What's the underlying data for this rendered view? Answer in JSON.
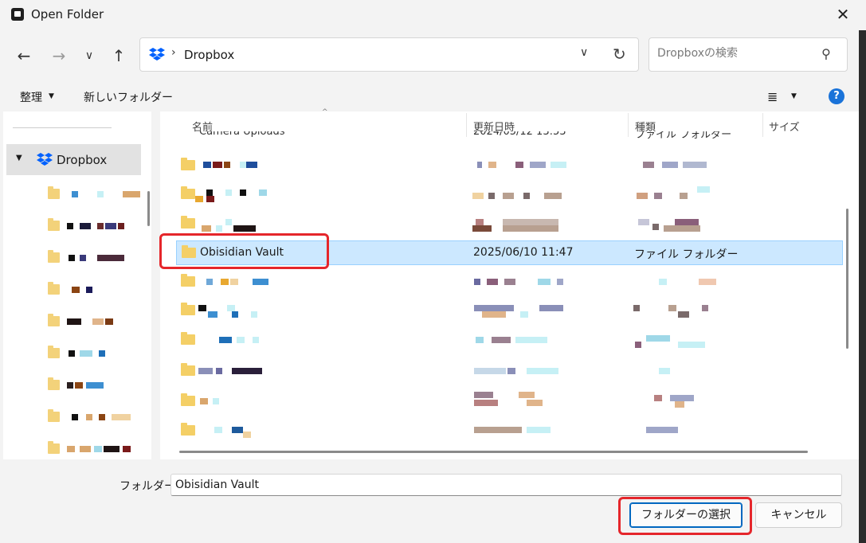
{
  "window": {
    "title": "Open Folder",
    "close_glyph": "✕"
  },
  "navigation": {
    "back_glyph": "←",
    "forward_glyph": "→",
    "recent_glyph": "∨",
    "up_glyph": "↑"
  },
  "address_bar": {
    "separator": "›",
    "path": "Dropbox",
    "chevron": "∨",
    "refresh_glyph": "↻"
  },
  "search": {
    "placeholder": "Dropboxの検索"
  },
  "toolbar": {
    "organize_label": "整理",
    "new_folder_label": "新しいフォルダー",
    "view_glyph": "≣",
    "help_glyph": "?"
  },
  "nav_pane": {
    "dropbox_label": "Dropbox"
  },
  "file_list": {
    "columns": {
      "name": "名前",
      "date": "更新日時",
      "type": "種類",
      "size": "サイズ"
    },
    "partial_row": {
      "name": "Camera Uploads",
      "date": "2024/05/12 13:53",
      "type": "ファイル フォルダー"
    },
    "selected_row": {
      "name": "Obisidian Vault",
      "date": "2025/06/10 11:47",
      "type": "ファイル フォルダー"
    }
  },
  "footer": {
    "folder_label": "フォルダー:",
    "folder_value": "Obisidian Vault",
    "select_button": "フォルダーの選択",
    "cancel_button": "キャンセル"
  },
  "colors": {
    "accent": "#0067c0",
    "selection": "#cce8ff",
    "annotation": "#e5262b",
    "folder": "#f4cf66"
  }
}
